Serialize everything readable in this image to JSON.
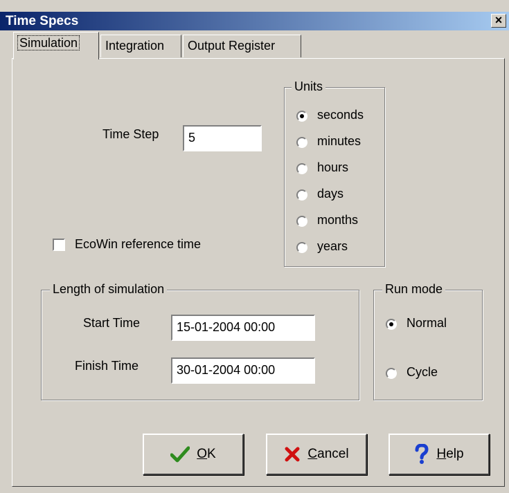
{
  "window": {
    "title": "Time Specs",
    "close_glyph": "×"
  },
  "tabs": [
    {
      "label": "Simulation",
      "active": true
    },
    {
      "label": "Integration",
      "active": false
    },
    {
      "label": "Output Register",
      "active": false
    }
  ],
  "time_step": {
    "label": "Time Step",
    "value": "5"
  },
  "units": {
    "title": "Units",
    "options": [
      {
        "label": "seconds",
        "checked": true
      },
      {
        "label": "minutes",
        "checked": false
      },
      {
        "label": "hours",
        "checked": false
      },
      {
        "label": "days",
        "checked": false
      },
      {
        "label": "months",
        "checked": false
      },
      {
        "label": "years",
        "checked": false
      }
    ]
  },
  "ecowin": {
    "label": "EcoWin reference time",
    "checked": false
  },
  "length": {
    "title": "Length of simulation",
    "start_label": "Start Time",
    "start_value": "15-01-2004 00:00",
    "finish_label": "Finish Time",
    "finish_value": "30-01-2004 00:00"
  },
  "run_mode": {
    "title": "Run mode",
    "options": [
      {
        "label": "Normal",
        "checked": true
      },
      {
        "label": "Cycle",
        "checked": false
      }
    ]
  },
  "buttons": {
    "ok": {
      "mnemonic": "O",
      "rest": "K",
      "icon": "checkmark-icon",
      "color": "#2e8b1e"
    },
    "cancel": {
      "mnemonic": "C",
      "rest": "ancel",
      "icon": "x-icon",
      "color": "#d01010"
    },
    "help": {
      "mnemonic": "H",
      "rest": "elp",
      "icon": "question-icon",
      "color": "#1a3fd0"
    }
  }
}
